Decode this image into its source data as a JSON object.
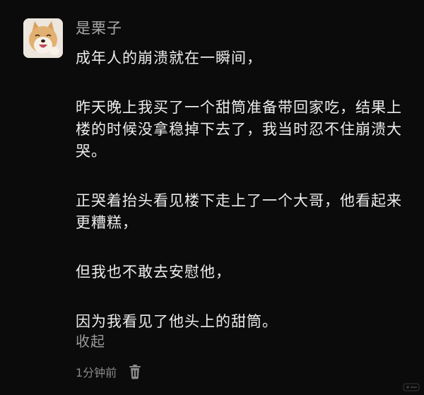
{
  "comment": {
    "author": "是栗子",
    "paragraphs": [
      "成年人的崩溃就在一瞬间，",
      "昨天晚上我买了一个甜筒准备带回家吃，结果上楼的时候没拿稳掉下去了，我当时忍不住崩溃大哭。",
      "正哭着抬头看见楼下走上了一个大哥，他看起来更糟糕，",
      "但我也不敢去安慰他，",
      "因为我看见了他头上的甜筒。"
    ],
    "collapse_label": "收起",
    "timestamp": "1分钟前",
    "avatar_icon": "shiba-dog-avatar",
    "delete_icon": "trash-icon"
  },
  "colors": {
    "background": "#0b0b0b",
    "text": "#ececec",
    "muted": "#9a9a9a"
  }
}
